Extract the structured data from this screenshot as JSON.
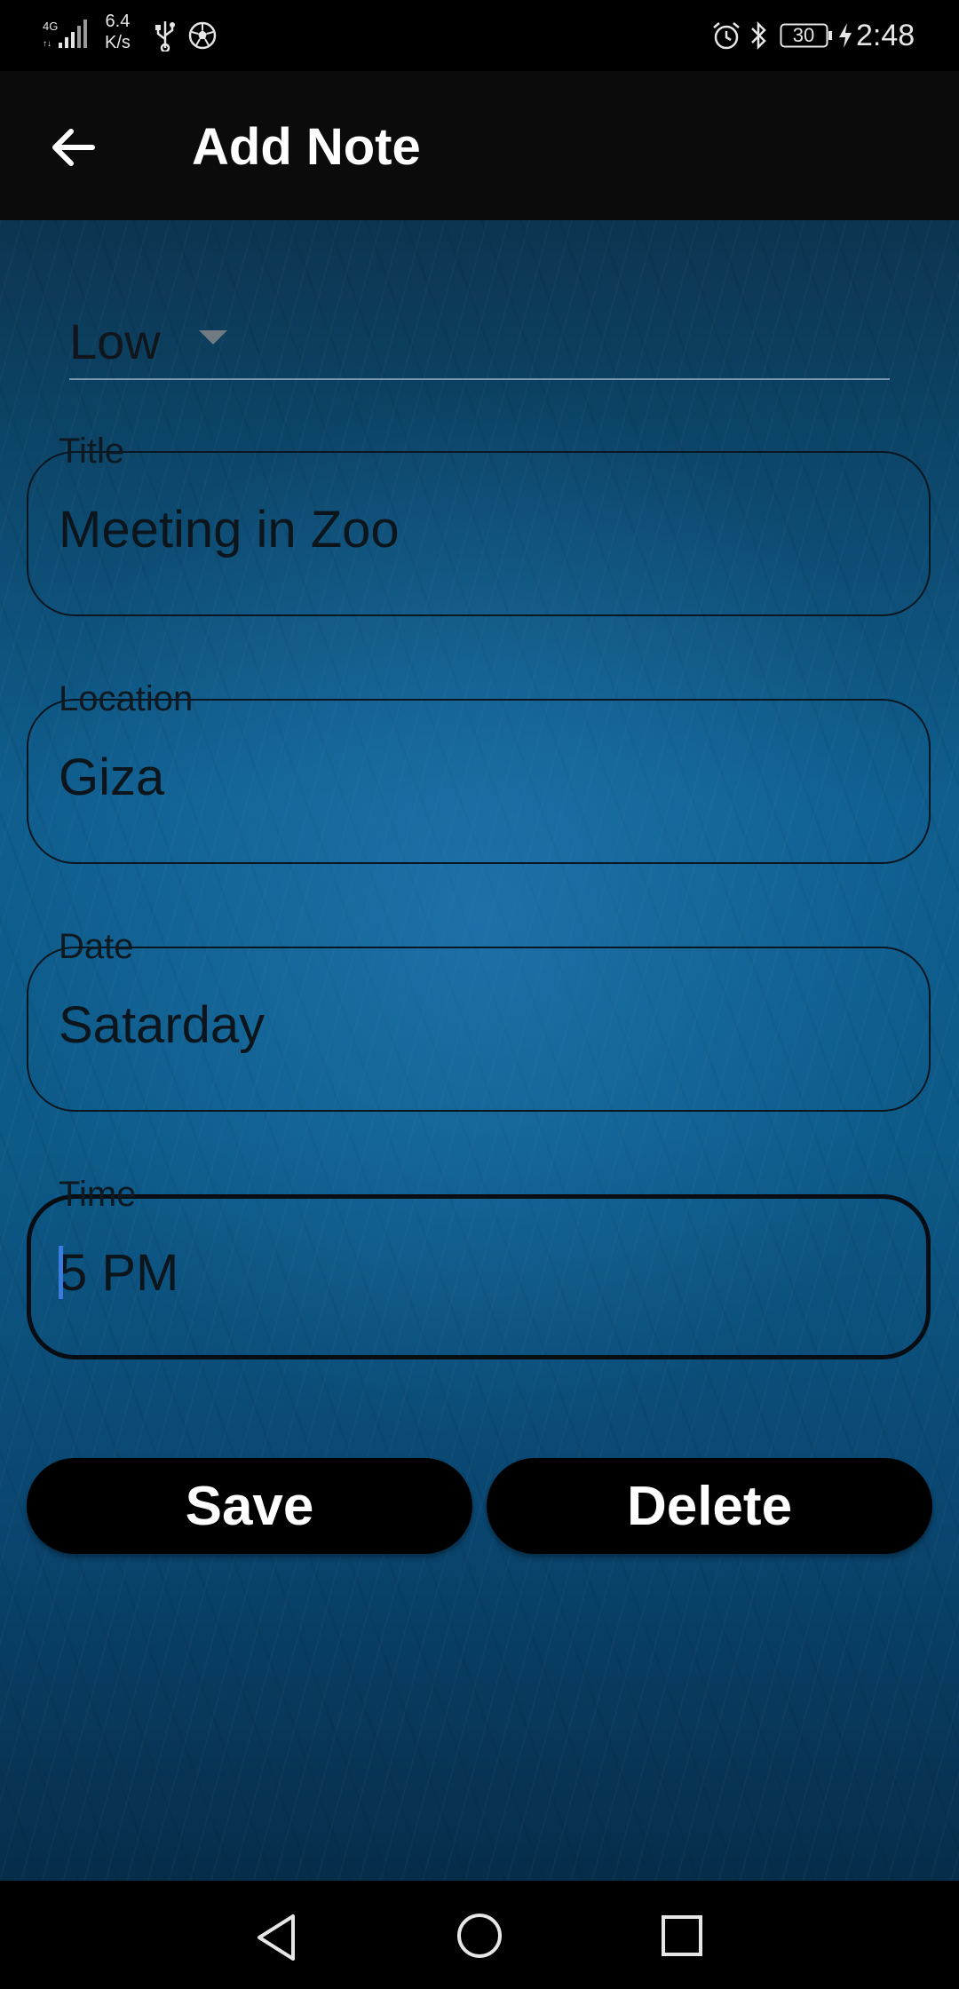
{
  "status_bar": {
    "network_type": "4G",
    "speed_value": "6.4",
    "speed_unit": "K/s",
    "battery": "30",
    "time": "2:48",
    "icons": [
      "signal-icon",
      "usb-icon",
      "soccer-ball-icon",
      "alarm-icon",
      "bluetooth-icon",
      "battery-icon",
      "charging-icon"
    ]
  },
  "app_bar": {
    "title": "Add Note",
    "back_icon": "back-arrow-icon"
  },
  "form": {
    "priority": {
      "selected": "Low",
      "icon": "dropdown-arrow-icon"
    },
    "title": {
      "label": "Title",
      "value": "Meeting in Zoo"
    },
    "location": {
      "label": "Location",
      "value": "Giza"
    },
    "date": {
      "label": "Date",
      "value": "Satarday"
    },
    "time": {
      "label": "Time",
      "value": "5 PM",
      "focused": true
    }
  },
  "actions": {
    "save_label": "Save",
    "delete_label": "Delete"
  },
  "nav_bar": {
    "icons": [
      "nav-back-icon",
      "nav-home-icon",
      "nav-recent-apps-icon"
    ]
  },
  "colors": {
    "background_top": "#0b3550",
    "background_mid": "#0f5e8e",
    "app_bar": "#0b0b0c",
    "button": "#000000",
    "caret": "#3a7be0"
  }
}
